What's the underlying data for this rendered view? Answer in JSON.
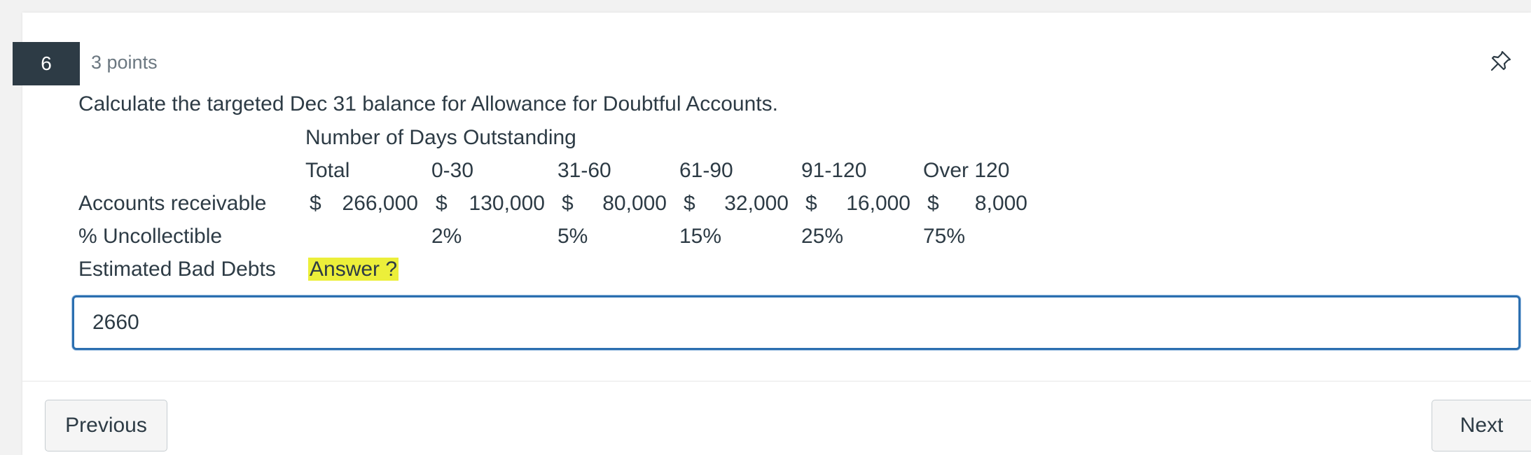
{
  "question": {
    "number": "6",
    "points": "3 points",
    "prompt": "Calculate the targeted Dec 31 balance for Allowance for Doubtful Accounts."
  },
  "table": {
    "group_header": "Number of Days Outstanding",
    "columns": [
      "Total",
      "0-30",
      "31-60",
      "61-90",
      "91-120",
      "Over 120"
    ],
    "rows": {
      "accounts_receivable": {
        "label": "Accounts receivable",
        "currency": "$",
        "values": [
          "266,000",
          "130,000",
          "80,000",
          "32,000",
          "16,000",
          "8,000"
        ]
      },
      "uncollectible": {
        "label": "% Uncollectible",
        "values": [
          "2%",
          "5%",
          "15%",
          "25%",
          "75%"
        ]
      },
      "bad_debts": {
        "label": "Estimated Bad Debts",
        "answer_label": "Answer ?",
        "highlight_color": "#ecef3a"
      }
    }
  },
  "answer_input": {
    "value": "2660"
  },
  "nav": {
    "previous_label": "Previous",
    "next_label": "Next"
  },
  "icons": {
    "pin": "pin-icon"
  },
  "colors": {
    "question_number_bg": "#2d3b45",
    "input_border": "#2b6fb0",
    "text": "#2d3b45"
  }
}
